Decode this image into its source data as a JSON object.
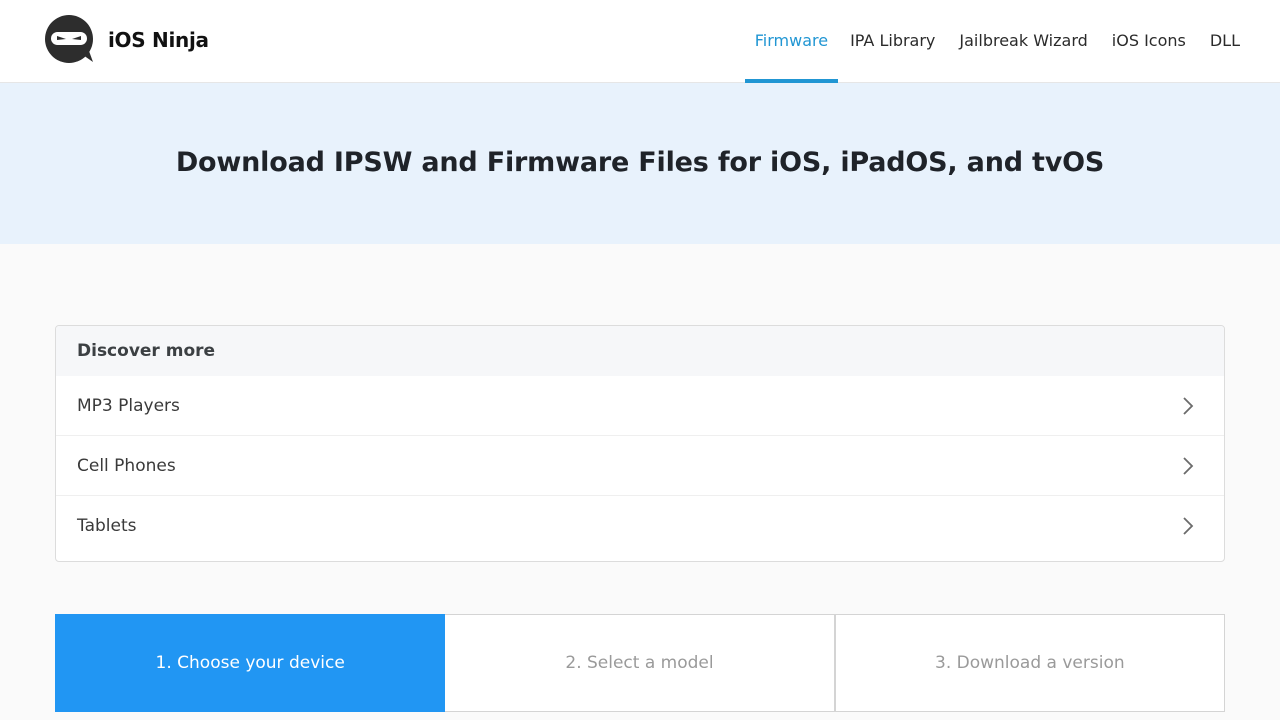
{
  "header": {
    "logo_text": "iOS Ninja",
    "nav": [
      {
        "label": "Firmware",
        "active": true
      },
      {
        "label": "IPA Library"
      },
      {
        "label": "Jailbreak Wizard"
      },
      {
        "label": "iOS Icons"
      },
      {
        "label": "DLL"
      }
    ]
  },
  "hero": {
    "title": "Download IPSW and Firmware Files for iOS, iPadOS, and tvOS"
  },
  "discover": {
    "heading": "Discover more",
    "items": [
      {
        "label": "MP3 Players",
        "icon": "chevron-right-icon"
      },
      {
        "label": "Cell Phones",
        "icon": "chevron-right-icon"
      },
      {
        "label": "Tablets",
        "icon": "chevron-right-icon"
      }
    ]
  },
  "steps": [
    {
      "label": "1. Choose your device",
      "active": true
    },
    {
      "label": "2. Select a model"
    },
    {
      "label": "3. Download a version"
    }
  ],
  "colors": {
    "accent": "#2196d3",
    "step_active": "#2196f3",
    "hero_bg": "#e8f2fc"
  }
}
